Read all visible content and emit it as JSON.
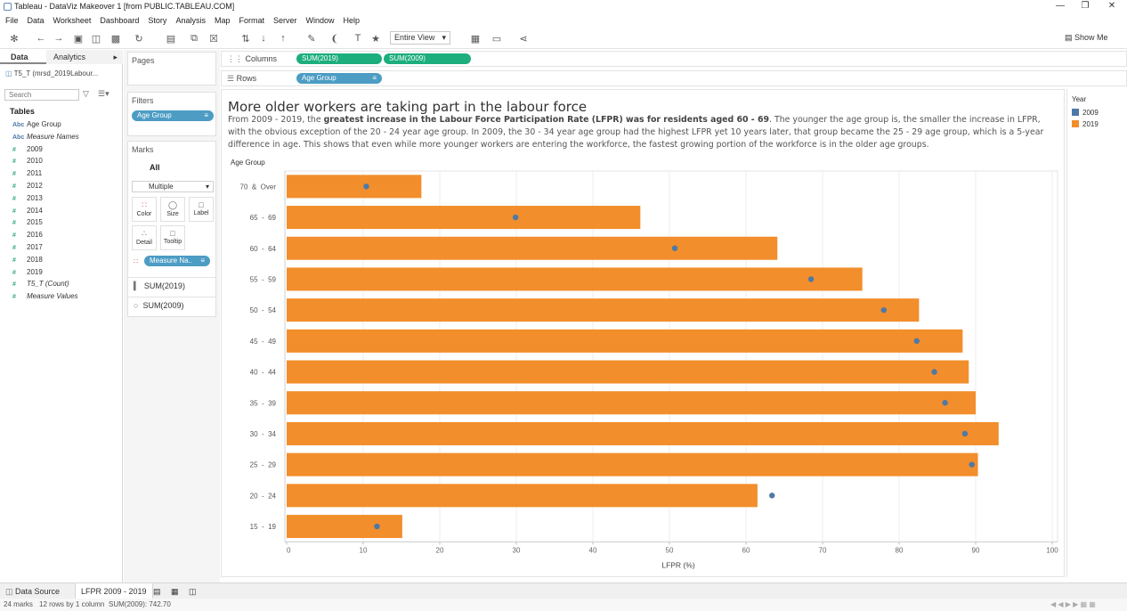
{
  "window": {
    "title": "Tableau - DataViz Makeover 1 [from PUBLIC.TABLEAU.COM]"
  },
  "menu": [
    "File",
    "Data",
    "Worksheet",
    "Dashboard",
    "Story",
    "Analysis",
    "Map",
    "Format",
    "Server",
    "Window",
    "Help"
  ],
  "toolbar": {
    "fit": "Entire View",
    "show_me": "Show Me"
  },
  "data_pane": {
    "tab_data": "Data",
    "tab_analytics": "Analytics",
    "datasource": "T5_T (mrsd_2019Labour...",
    "search_placeholder": "Search",
    "tables_title": "Tables",
    "fields": [
      {
        "type": "Abc",
        "name": "Age Group"
      },
      {
        "type": "Abc",
        "name": "Measure Names"
      },
      {
        "type": "#",
        "name": "2009"
      },
      {
        "type": "#",
        "name": "2010"
      },
      {
        "type": "#",
        "name": "2011"
      },
      {
        "type": "#",
        "name": "2012"
      },
      {
        "type": "#",
        "name": "2013"
      },
      {
        "type": "#",
        "name": "2014"
      },
      {
        "type": "#",
        "name": "2015"
      },
      {
        "type": "#",
        "name": "2016"
      },
      {
        "type": "#",
        "name": "2017"
      },
      {
        "type": "#",
        "name": "2018"
      },
      {
        "type": "#",
        "name": "2019"
      },
      {
        "type": "#",
        "name": "T5_T (Count)"
      },
      {
        "type": "#",
        "name": "Measure Values"
      }
    ]
  },
  "shelves": {
    "pages": "Pages",
    "filters": "Filters",
    "filter_pill": "Age Group",
    "marks": "Marks",
    "marks_all": "All",
    "mark_type": "Multiple",
    "mark_buttons": [
      "Color",
      "Size",
      "Label",
      "Detail",
      "Tooltip"
    ],
    "marks_pill": "Measure Na..",
    "marks_sum2019": "SUM(2019)",
    "marks_sum2009": "SUM(2009)",
    "columns_label": "Columns",
    "rows_label": "Rows",
    "columns_pills": [
      "SUM(2019)",
      "SUM(2009)"
    ],
    "rows_pill": "Age Group"
  },
  "view": {
    "title": "More older workers are taking part in the labour force",
    "desc_1": "From 2009 - 2019, the ",
    "desc_bold": "greatest increase in the Labour Force Participation Rate (LFPR) was for residents aged 60 - 69",
    "desc_2": ". The younger the age group is, the smaller the increase in LFPR, with the obvious exception of the 20 - 24 year age group. In 2009, the 30 - 34 year age group had the highest LFPR yet 10 years later, that group became the 25 - 29 age group, which is  a 5-year difference in age. This shows that even while more younger workers are entering the workforce, the fastest growing portion of the workforce is in the older age groups."
  },
  "legend": {
    "title": "Year",
    "items": [
      {
        "label": "2009",
        "color": "#4e79a7"
      },
      {
        "label": "2019",
        "color": "#f28e2b"
      }
    ]
  },
  "chart_data": {
    "type": "bar",
    "row_header": "Age Group",
    "xlabel": "LFPR (%)",
    "xlim": [
      0,
      100
    ],
    "xticks": [
      0,
      10,
      20,
      30,
      40,
      50,
      60,
      70,
      80,
      90,
      100
    ],
    "categories": [
      "70  &  Over",
      "65  -  69",
      "60  -  64",
      "55  -  59",
      "50  -  54",
      "45  -  49",
      "40  -  44",
      "35  -  39",
      "30  -  34",
      "25  -  29",
      "20  -  24",
      "15  -  19"
    ],
    "series": [
      {
        "name": "2019",
        "mark": "bar",
        "color": "#f28e2b",
        "values": [
          17.6,
          46.2,
          64.1,
          75.2,
          82.6,
          88.3,
          89.1,
          90.0,
          93.0,
          90.3,
          61.5,
          15.1
        ]
      },
      {
        "name": "2009",
        "mark": "circle",
        "color": "#4e79a7",
        "values": [
          10.4,
          29.9,
          50.7,
          68.5,
          78.0,
          82.3,
          84.6,
          86.0,
          88.6,
          89.5,
          63.4,
          11.8
        ]
      }
    ]
  },
  "tabs": {
    "data_source": "Data Source",
    "sheet": "LFPR 2009 - 2019"
  },
  "status": {
    "marks": "24 marks",
    "rows": "12 rows by 1 column",
    "sum": "SUM(2009): 742.70"
  }
}
